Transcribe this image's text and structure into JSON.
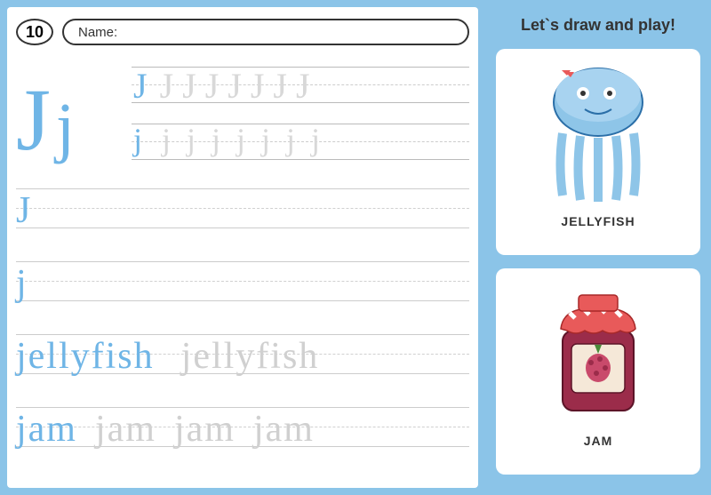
{
  "header": {
    "page_number": "10",
    "name_label": "Name:"
  },
  "letters": {
    "upper": "J",
    "lower": "j"
  },
  "trace": {
    "upper_row": "J J J J J J J J",
    "lower_row": "j j j j j j j j"
  },
  "practice": {
    "row1": "J",
    "row2": "j",
    "row3_main": "jellyfish",
    "row3_faded": "jellyfish",
    "row4_main": "jam",
    "row4_rep": "jam"
  },
  "sidebar": {
    "title": "Let`s draw and play!",
    "card1_label": "JELLYFISH",
    "card2_label": "JAM"
  }
}
